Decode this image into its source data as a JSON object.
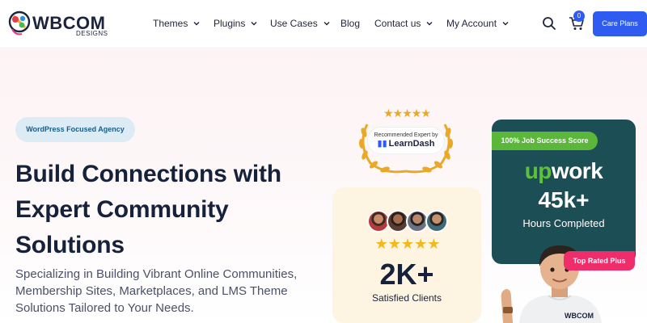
{
  "brand": {
    "name": "WBCOM",
    "tagline": "DESIGNS"
  },
  "nav": {
    "items": [
      {
        "label": "Themes",
        "dropdown": true
      },
      {
        "label": "Plugins",
        "dropdown": true
      },
      {
        "label": "Use Cases",
        "dropdown": true
      },
      {
        "label": "Blog",
        "dropdown": false
      },
      {
        "label": "Contact us",
        "dropdown": true
      },
      {
        "label": "My Account",
        "dropdown": true
      }
    ],
    "search_icon": "search-icon",
    "cart_icon": "cart-icon",
    "cart_count": "0",
    "cta_label": "Care Plans"
  },
  "hero": {
    "pill": "WordPress Focused Agency",
    "headline_lines": [
      "Build Connections with",
      "Expert Community",
      "Solutions"
    ],
    "subtext_lines": [
      "Specializing in Building Vibrant Online Communities,",
      "Membership Sites, Marketplaces, and LMS Theme",
      "Solutions Tailored to Your Needs."
    ]
  },
  "learndash": {
    "stars": "★★★★★",
    "label": "Recommended Expert by",
    "brand": "LearnDash"
  },
  "clients": {
    "stars": "★★★★★",
    "count": "2K+",
    "label": "Satisfied Clients"
  },
  "upwork": {
    "tag": "100% Job Success Score",
    "logo_up": "up",
    "logo_rest": "work",
    "hours": "45k+",
    "hours_label": "Hours Completed",
    "badge": "Top Rated Plus"
  },
  "colors": {
    "accent": "#2f5bf0",
    "upwork_card": "#1c4f55",
    "upwork_green": "#5ab73a",
    "badge_pink": "#f02d6b",
    "clients_bg": "#fdf4e1",
    "pill_bg": "#dcebf4"
  }
}
